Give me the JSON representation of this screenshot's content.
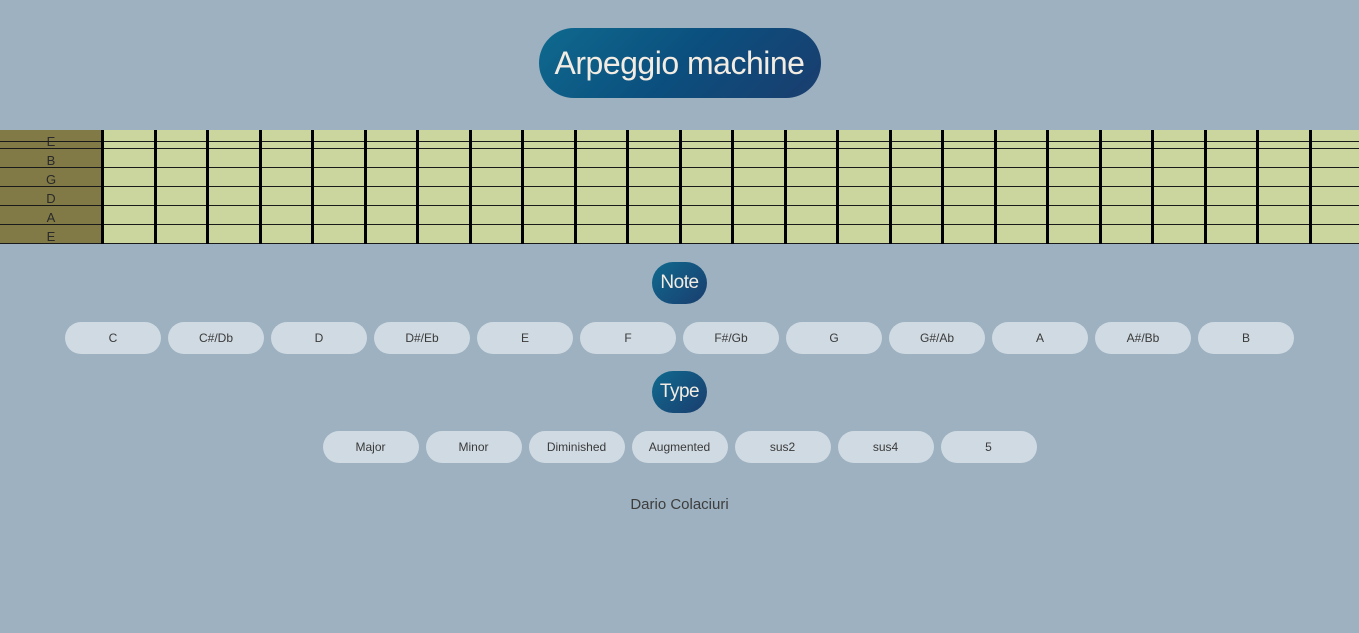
{
  "app": {
    "title": "Arpeggio machine"
  },
  "fretboard": {
    "strings": [
      "E",
      "B",
      "G",
      "D",
      "A",
      "E"
    ],
    "fret_count": 24
  },
  "note_section": {
    "label": "Note",
    "options": [
      "C",
      "C#/Db",
      "D",
      "D#/Eb",
      "E",
      "F",
      "F#/Gb",
      "G",
      "G#/Ab",
      "A",
      "A#/Bb",
      "B"
    ]
  },
  "type_section": {
    "label": "Type",
    "options": [
      "Major",
      "Minor",
      "Diminished",
      "Augmented",
      "sus2",
      "sus4",
      "5"
    ]
  },
  "footer": {
    "author": "Dario Colaciuri"
  },
  "colors": {
    "background": "#9db1c0",
    "fretboard": "#cbd59e",
    "nut": "#817a47",
    "pill_button": "#d0dae2",
    "accent_gradient_start": "#0f6a8f",
    "accent_gradient_end": "#1a3d6e"
  }
}
